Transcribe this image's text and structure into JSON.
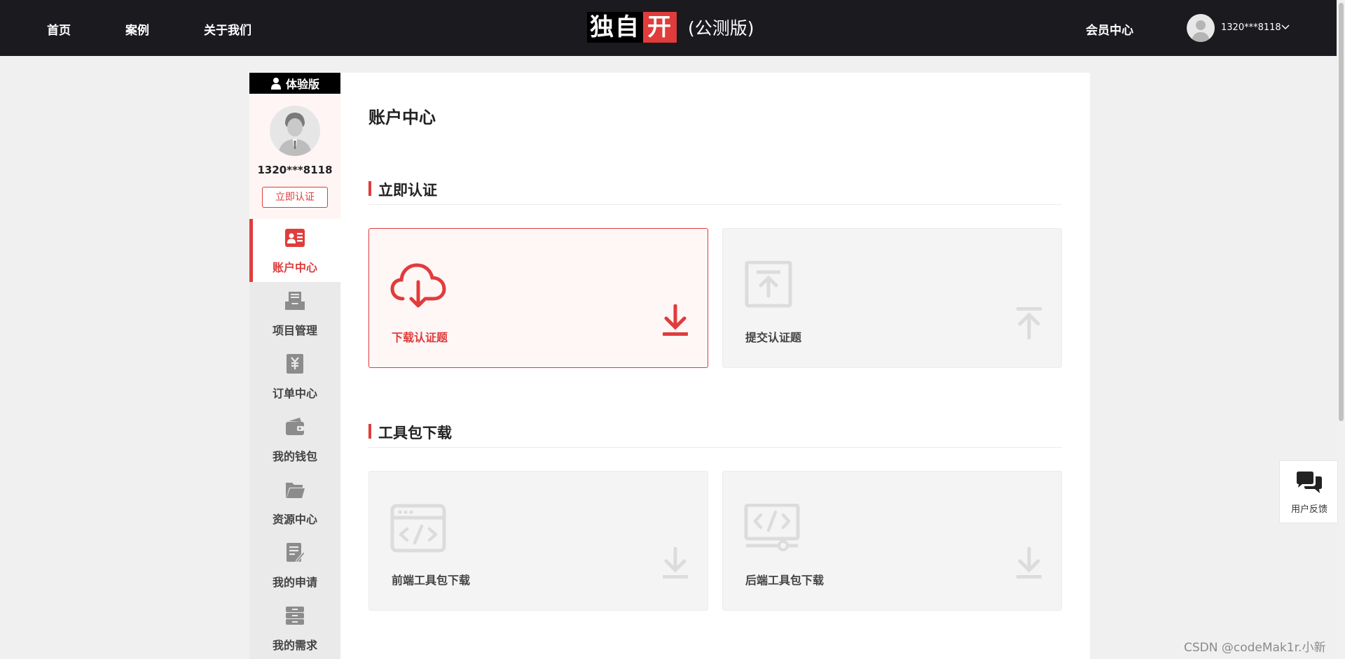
{
  "header": {
    "nav": [
      "首页",
      "案例",
      "关于我们"
    ],
    "logo_part1": "独自",
    "logo_part2": "开",
    "logo_suffix": "(公测版)",
    "member_center": "会员中心",
    "username": "1320***8118"
  },
  "sidebar": {
    "badge": "体验版",
    "username": "1320***8118",
    "verify_button": "立即认证",
    "items": [
      {
        "label": "账户中心",
        "icon": "id-card-icon",
        "active": true
      },
      {
        "label": "项目管理",
        "icon": "inbox-icon"
      },
      {
        "label": "订单中心",
        "icon": "yuan-document-icon"
      },
      {
        "label": "我的钱包",
        "icon": "wallet-icon"
      },
      {
        "label": "资源中心",
        "icon": "folder-icon"
      },
      {
        "label": "我的申请",
        "icon": "edit-document-icon"
      },
      {
        "label": "我的需求",
        "icon": "archive-icon"
      }
    ]
  },
  "main": {
    "title": "账户中心",
    "sections": [
      {
        "title": "立即认证",
        "cards": [
          {
            "label": "下载认证题",
            "icon": "cloud-download-icon",
            "active": true
          },
          {
            "label": "提交认证题",
            "icon": "upload-box-icon"
          }
        ]
      },
      {
        "title": "工具包下载",
        "cards": [
          {
            "label": "前端工具包下载",
            "icon": "browser-code-icon"
          },
          {
            "label": "后端工具包下载",
            "icon": "monitor-code-icon"
          }
        ]
      }
    ]
  },
  "feedback": {
    "label": "用户反馈",
    "icon": "chat-bubbles-icon"
  },
  "watermark": "CSDN @codeMak1r.小新",
  "colors": {
    "accent": "#e03c3c",
    "header_bg": "#1b1a1f",
    "page_bg": "#f0f0f0"
  }
}
